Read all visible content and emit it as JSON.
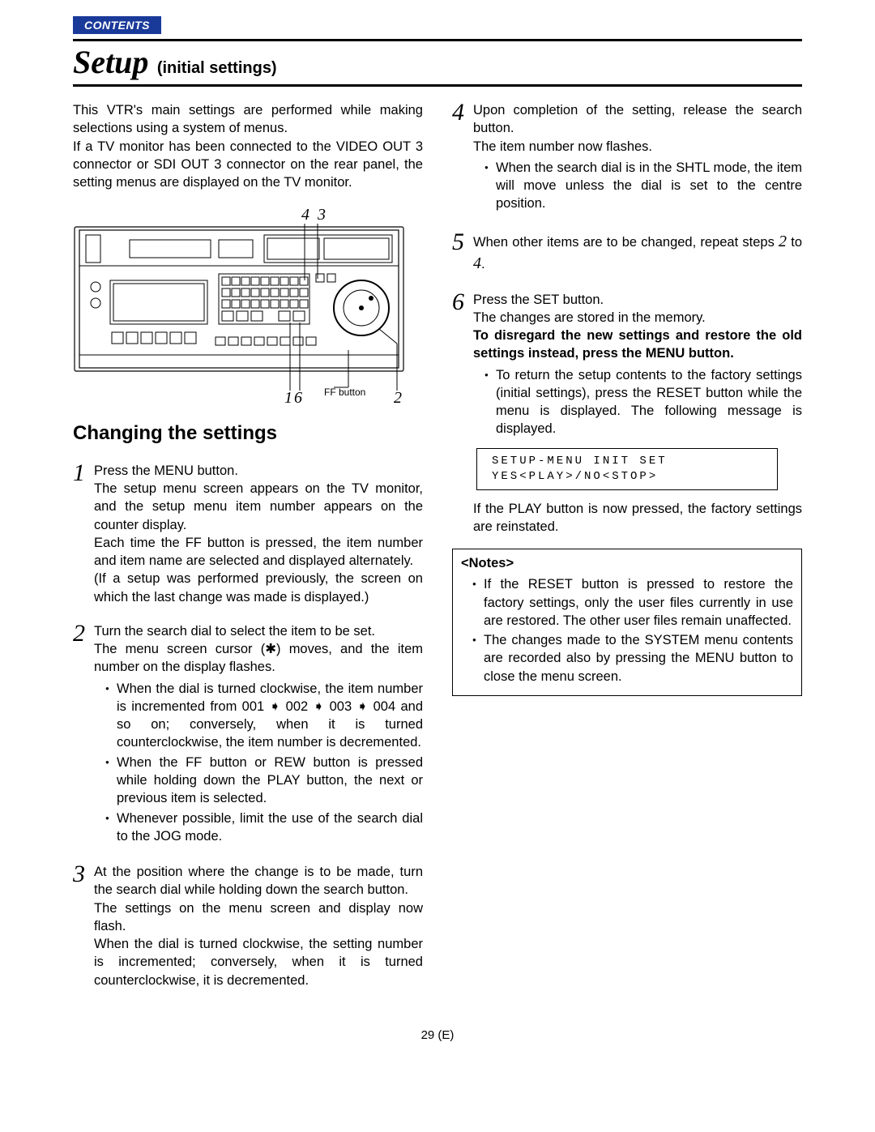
{
  "nav": {
    "contents": "CONTENTS"
  },
  "title": {
    "setup": "Setup",
    "subtitle": "(initial settings)"
  },
  "left": {
    "intro": "This VTR's main settings are performed while making selections using a system of menus.\nIf a TV monitor has been connected to the VIDEO OUT 3 connector or SDI OUT 3 connector on the rear panel, the setting menus are displayed on the TV monitor.",
    "figure": {
      "callouts": {
        "top_left": "4",
        "top_right": "3",
        "bottom_left_a": "1",
        "bottom_left_b": "6",
        "bottom_right": "2"
      },
      "ff_button": "FF button"
    },
    "subhead": "Changing the settings",
    "steps": {
      "s1": {
        "num": "1",
        "p1": "Press the MENU button.",
        "p2": "The setup menu screen appears on the TV monitor, and the setup menu item number appears on the counter display.",
        "p3": "Each time the FF button is pressed, the item number and item name are selected and displayed alternately.",
        "p4": "(If a setup was performed previously, the screen on which the last change was made is displayed.)"
      },
      "s2": {
        "num": "2",
        "p1": "Turn the search dial to select the item to be set.",
        "p2": "The menu screen cursor (✱) moves, and the item number on the display flashes.",
        "b1": "When the dial is turned clockwise, the item number is incremented from 001 ➧ 002 ➧ 003 ➧ 004 and so on; conversely, when it is turned counterclockwise, the item number is decremented.",
        "b2": "When the FF button or REW button is pressed while holding down the PLAY button, the next or previous item is selected.",
        "b3": "Whenever possible, limit the use of the search dial to the JOG mode."
      },
      "s3": {
        "num": "3",
        "p1": "At the position where the change is to be made, turn the search dial while holding down the search button.",
        "p2": "The settings on the menu screen and display now flash.",
        "p3": "When the dial is turned clockwise, the setting number is incremented; conversely, when it is turned counterclockwise, it is decremented."
      }
    }
  },
  "right": {
    "s4": {
      "num": "4",
      "p1": "Upon completion of the setting, release the search button.",
      "p2": "The item number now flashes.",
      "b1": "When the search dial is in the SHTL mode, the item will move unless the dial is set to the centre position."
    },
    "s5": {
      "num": "5",
      "p1a": "When other items are to be changed, repeat steps ",
      "p1b": "2",
      "p1c": " to ",
      "p1d": "4",
      "p1e": "."
    },
    "s6": {
      "num": "6",
      "p1": "Press the SET button.",
      "p2": "The changes are stored in the memory.",
      "strong": "To disregard the new settings and restore the old settings instead, press the MENU button.",
      "b1": "To return the setup contents to the factory settings (initial settings), press the RESET button while the menu is displayed.  The following message is displayed."
    },
    "screen": {
      "line1": "SETUP-MENU INIT SET",
      "line2": "YES<PLAY>/NO<STOP>"
    },
    "after_msg": "If the PLAY button is now pressed, the factory settings are reinstated.",
    "notes": {
      "title": "<Notes>",
      "n1": "If the RESET button is pressed to restore the factory settings, only the user files currently in use are restored. The other user files remain unaffected.",
      "n2": "The changes made to the SYSTEM menu contents are recorded also by pressing the MENU button to close the menu screen."
    }
  },
  "page_number": "29 (E)"
}
